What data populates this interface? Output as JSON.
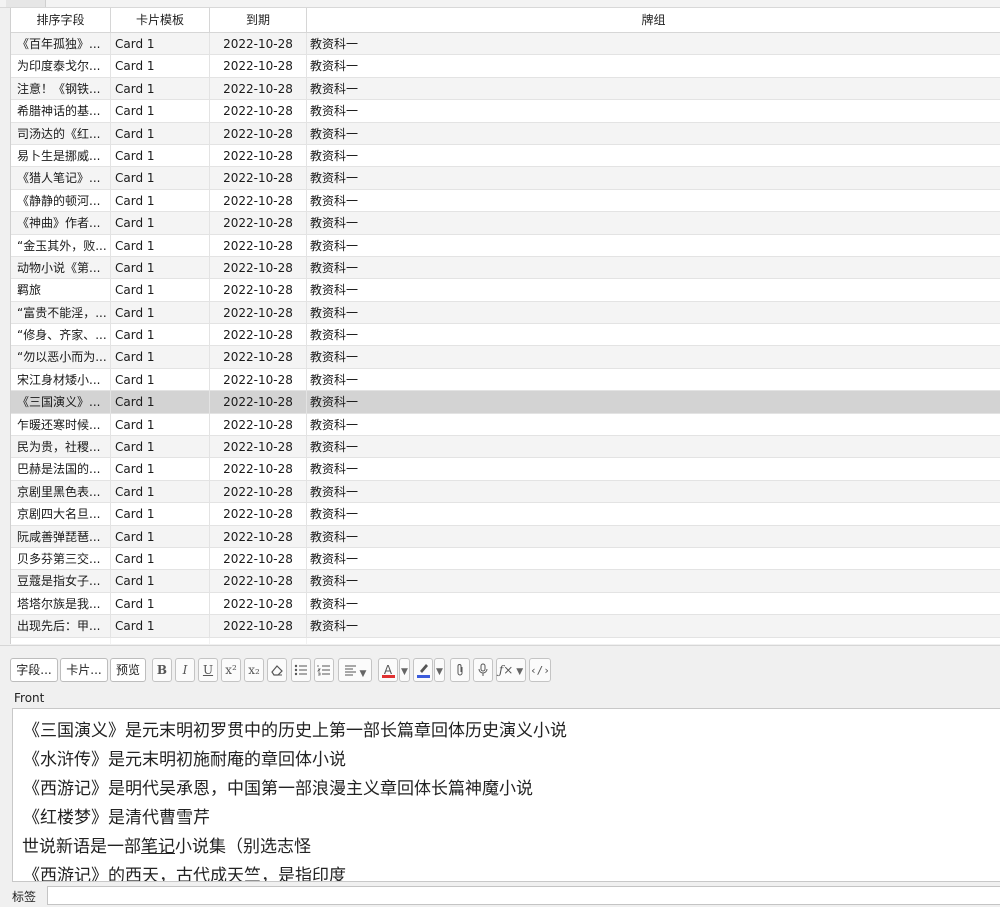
{
  "table": {
    "columns": [
      "排序字段",
      "卡片模板",
      "到期",
      "牌组"
    ],
    "rows": [
      {
        "sort": "《百年孤独》...",
        "card": "Card 1",
        "due": "2022-10-28",
        "deck": "教资科一"
      },
      {
        "sort": "为印度泰戈尔...",
        "card": "Card 1",
        "due": "2022-10-28",
        "deck": "教资科一"
      },
      {
        "sort": "注意！《钢铁...",
        "card": "Card 1",
        "due": "2022-10-28",
        "deck": "教资科一"
      },
      {
        "sort": "希腊神话的基...",
        "card": "Card 1",
        "due": "2022-10-28",
        "deck": "教资科一"
      },
      {
        "sort": "司汤达的《红...",
        "card": "Card 1",
        "due": "2022-10-28",
        "deck": "教资科一"
      },
      {
        "sort": "易卜生是挪威...",
        "card": "Card 1",
        "due": "2022-10-28",
        "deck": "教资科一"
      },
      {
        "sort": "《猎人笔记》...",
        "card": "Card 1",
        "due": "2022-10-28",
        "deck": "教资科一"
      },
      {
        "sort": "《静静的顿河...",
        "card": "Card 1",
        "due": "2022-10-28",
        "deck": "教资科一"
      },
      {
        "sort": "《神曲》作者...",
        "card": "Card 1",
        "due": "2022-10-28",
        "deck": "教资科一"
      },
      {
        "sort": "“金玉其外，败...",
        "card": "Card 1",
        "due": "2022-10-28",
        "deck": "教资科一"
      },
      {
        "sort": "动物小说《第...",
        "card": "Card 1",
        "due": "2022-10-28",
        "deck": "教资科一"
      },
      {
        "sort": "羁旅",
        "card": "Card 1",
        "due": "2022-10-28",
        "deck": "教资科一"
      },
      {
        "sort": "“富贵不能淫，...",
        "card": "Card 1",
        "due": "2022-10-28",
        "deck": "教资科一"
      },
      {
        "sort": "“修身、齐家、...",
        "card": "Card 1",
        "due": "2022-10-28",
        "deck": "教资科一"
      },
      {
        "sort": "“勿以恶小而为...",
        "card": "Card 1",
        "due": "2022-10-28",
        "deck": "教资科一"
      },
      {
        "sort": "宋江身材矮小...",
        "card": "Card 1",
        "due": "2022-10-28",
        "deck": "教资科一"
      },
      {
        "sort": "《三国演义》...",
        "card": "Card 1",
        "due": "2022-10-28",
        "deck": "教资科一"
      },
      {
        "sort": "乍暖还寒时候...",
        "card": "Card 1",
        "due": "2022-10-28",
        "deck": "教资科一"
      },
      {
        "sort": "民为贵，社稷...",
        "card": "Card 1",
        "due": "2022-10-28",
        "deck": "教资科一"
      },
      {
        "sort": "巴赫是法国的...",
        "card": "Card 1",
        "due": "2022-10-28",
        "deck": "教资科一"
      },
      {
        "sort": "京剧里黑色表...",
        "card": "Card 1",
        "due": "2022-10-28",
        "deck": "教资科一"
      },
      {
        "sort": "京剧四大名旦...",
        "card": "Card 1",
        "due": "2022-10-28",
        "deck": "教资科一"
      },
      {
        "sort": "阮咸善弹琵琶...",
        "card": "Card 1",
        "due": "2022-10-28",
        "deck": "教资科一"
      },
      {
        "sort": "贝多芬第三交...",
        "card": "Card 1",
        "due": "2022-10-28",
        "deck": "教资科一"
      },
      {
        "sort": "豆蔻是指女子...",
        "card": "Card 1",
        "due": "2022-10-28",
        "deck": "教资科一"
      },
      {
        "sort": "塔塔尔族是我...",
        "card": "Card 1",
        "due": "2022-10-28",
        "deck": "教资科一"
      },
      {
        "sort": "出现先后：甲...",
        "card": "Card 1",
        "due": "2022-10-28",
        "deck": "教资科一"
      },
      {
        "sort": "",
        "card": "",
        "due": "",
        "deck": ""
      }
    ]
  },
  "toolbar": {
    "fields_label": "字段...",
    "cards_label": "卡片...",
    "preview_label": "预览",
    "bold": "B",
    "italic": "I",
    "underline": "U",
    "superscript": "x²",
    "subscript": "x₂",
    "eraser_icon": "eraser-icon",
    "colors": {
      "text_color": "#e03131",
      "highlight_color": "#3b5bdb"
    }
  },
  "editor": {
    "field_label": "Front",
    "lines": [
      "《三国演义》是元末明初罗贯中的历史上第一部长篇章回体历史演义小说",
      "《水浒传》是元末明初施耐庵的章回体小说",
      "《西游记》是明代吴承恩，中国第一部浪漫主义章回体长篇神魔小说",
      "《红楼梦》是清代曹雪芹"
    ],
    "line5_pre": "世说新语是一部",
    "line5_ul": "笔记",
    "line5_post": "小说集（别选志怪",
    "line6": "《西游记》的西天，古代成天竺，是指印度"
  },
  "tags": {
    "label": "标签",
    "value": ""
  }
}
